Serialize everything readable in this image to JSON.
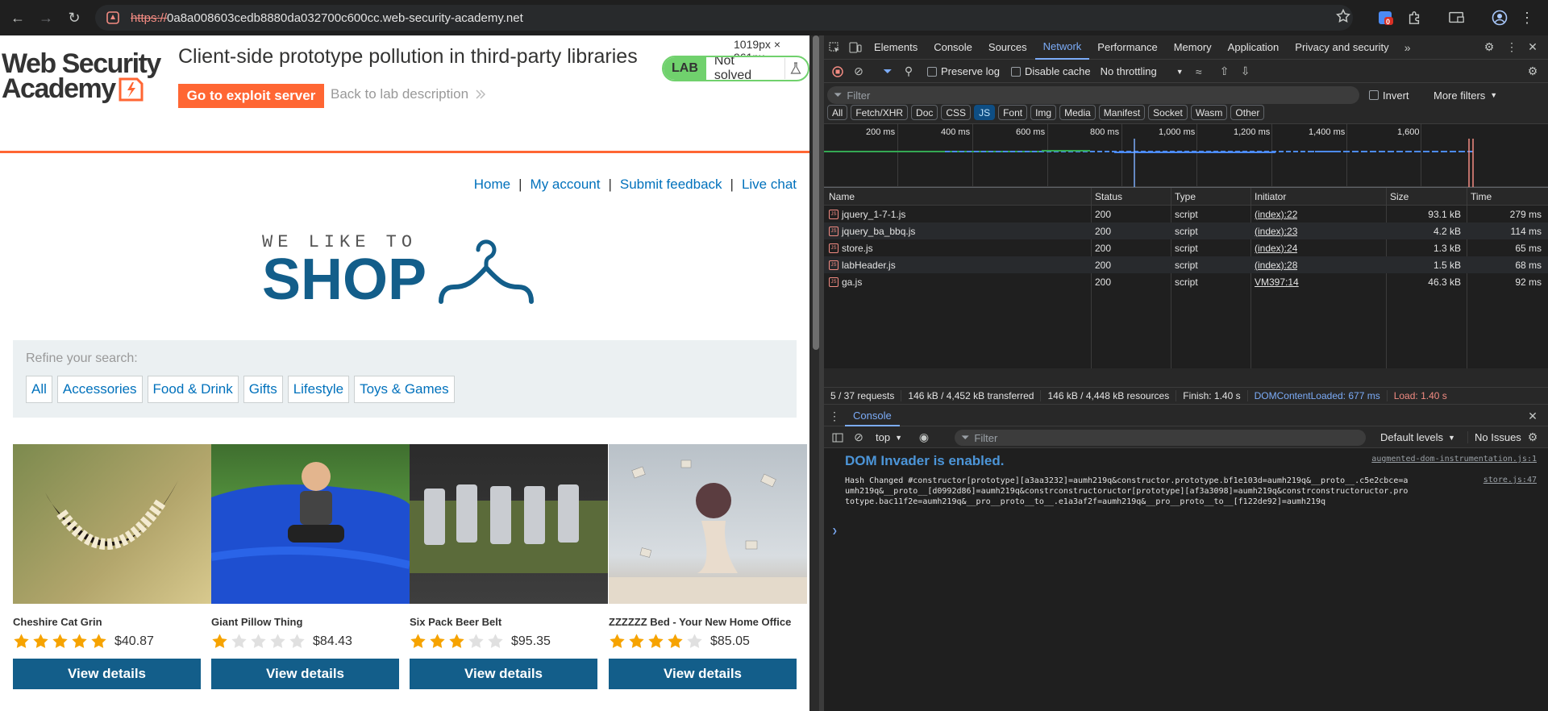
{
  "browser": {
    "url_protocol": "https://",
    "url_host": "0a8a008603cedb8880da032700c600cc.web-security-academy.net",
    "notification_count": "0"
  },
  "lab": {
    "logo_line1": "Web Security",
    "logo_line2": "Academy",
    "title": "Client-side prototype pollution in third-party libraries",
    "exploit_button": "Go to exploit server",
    "back_link": "Back to lab description",
    "status_tag": "LAB",
    "status_text": "Not solved",
    "viewport_size": "1019px × 961px"
  },
  "site": {
    "nav": [
      "Home",
      "My account",
      "Submit feedback",
      "Live chat"
    ],
    "logo_small": "WE LIKE TO",
    "logo_big": "SHOP",
    "refine_label": "Refine your search:",
    "filters": [
      "All",
      "Accessories",
      "Food & Drink",
      "Gifts",
      "Lifestyle",
      "Toys & Games"
    ],
    "view_button": "View details",
    "products": [
      {
        "name": "Cheshire Cat Grin",
        "price": "$40.87",
        "rating": 5
      },
      {
        "name": "Giant Pillow Thing",
        "price": "$84.43",
        "rating": 1
      },
      {
        "name": "Six Pack Beer Belt",
        "price": "$95.35",
        "rating": 3
      },
      {
        "name": "ZZZZZZ Bed - Your New Home Office",
        "price": "$85.05",
        "rating": 4
      }
    ]
  },
  "devtools": {
    "tabs": [
      "Elements",
      "Console",
      "Sources",
      "Network",
      "Performance",
      "Memory",
      "Application",
      "Privacy and security"
    ],
    "active_tab": "Network",
    "preserve_log": "Preserve log",
    "disable_cache": "Disable cache",
    "throttling": "No throttling",
    "filter_placeholder": "Filter",
    "invert": "Invert",
    "more_filters": "More filters",
    "type_filters": [
      "All",
      "Fetch/XHR",
      "Doc",
      "CSS",
      "JS",
      "Font",
      "Img",
      "Media",
      "Manifest",
      "Socket",
      "Wasm",
      "Other"
    ],
    "active_type": "JS",
    "timeline_ticks": [
      "200 ms",
      "400 ms",
      "600 ms",
      "800 ms",
      "1,000 ms",
      "1,200 ms",
      "1,400 ms",
      "1,600"
    ],
    "columns": [
      "Name",
      "Status",
      "Type",
      "Initiator",
      "Size",
      "Time"
    ],
    "requests": [
      {
        "name": "jquery_1-7-1.js",
        "status": "200",
        "type": "script",
        "initiator": "(index):22",
        "size": "93.1 kB",
        "time": "279 ms"
      },
      {
        "name": "jquery_ba_bbq.js",
        "status": "200",
        "type": "script",
        "initiator": "(index):23",
        "size": "4.2 kB",
        "time": "114 ms"
      },
      {
        "name": "store.js",
        "status": "200",
        "type": "script",
        "initiator": "(index):24",
        "size": "1.3 kB",
        "time": "65 ms"
      },
      {
        "name": "labHeader.js",
        "status": "200",
        "type": "script",
        "initiator": "(index):28",
        "size": "1.5 kB",
        "time": "68 ms"
      },
      {
        "name": "ga.js",
        "status": "200",
        "type": "script",
        "initiator": "VM397:14",
        "size": "46.3 kB",
        "time": "92 ms"
      }
    ],
    "summary": {
      "requests": "5 / 37 requests",
      "transferred": "146 kB / 4,452 kB transferred",
      "resources": "146 kB / 4,448 kB resources",
      "finish": "Finish: 1.40 s",
      "dcl": "DOMContentLoaded: 677 ms",
      "load": "Load: 1.40 s"
    },
    "console": {
      "drawer_tab": "Console",
      "context": "top",
      "filter_placeholder": "Filter",
      "levels": "Default levels",
      "issues": "No Issues",
      "dom_invader": "DOM Invader is enabled.",
      "dom_invader_src": "augmented-dom-instrumentation.js:1",
      "hash_message": "Hash Changed #constructor[prototype][a3aa3232]=aumh219q&constructor.prototype.bf1e103d=aumh219q&__proto__.c5e2cbce=aumh219q&__proto__[d0992d86]=aumh219q&constrconstructoructor[prototype][af3a3098]=aumh219q&constrconstructoructor.prototype.bac11f2e=aumh219q&__pro__proto__to__.e1a3af2f=aumh219q&__pro__proto__to__[f122de92]=aumh219q",
      "hash_src": "store.js:47"
    }
  }
}
